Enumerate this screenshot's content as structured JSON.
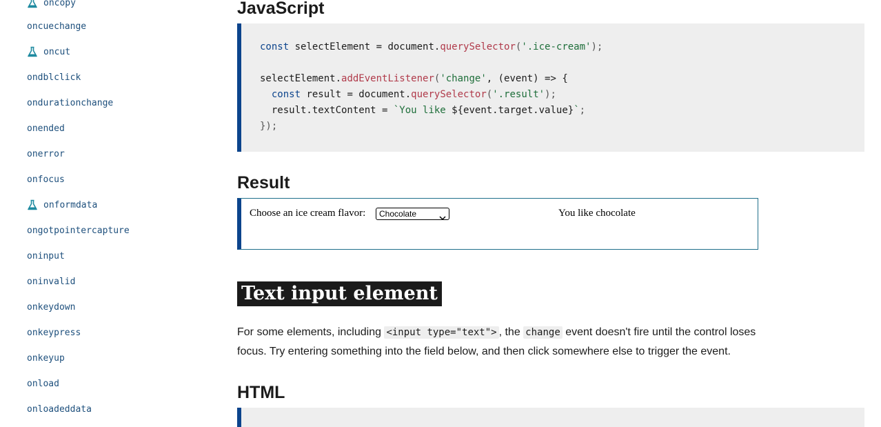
{
  "sidebar": {
    "items": [
      {
        "label": "oncopy",
        "experimental": true
      },
      {
        "label": "oncuechange",
        "experimental": false
      },
      {
        "label": "oncut",
        "experimental": true
      },
      {
        "label": "ondblclick",
        "experimental": false
      },
      {
        "label": "ondurationchange",
        "experimental": false
      },
      {
        "label": "onended",
        "experimental": false
      },
      {
        "label": "onerror",
        "experimental": false
      },
      {
        "label": "onfocus",
        "experimental": false
      },
      {
        "label": "onformdata",
        "experimental": true
      },
      {
        "label": "ongotpointercapture",
        "experimental": false
      },
      {
        "label": "oninput",
        "experimental": false
      },
      {
        "label": "oninvalid",
        "experimental": false
      },
      {
        "label": "onkeydown",
        "experimental": false
      },
      {
        "label": "onkeypress",
        "experimental": false
      },
      {
        "label": "onkeyup",
        "experimental": false
      },
      {
        "label": "onload",
        "experimental": false
      },
      {
        "label": "onloadeddata",
        "experimental": false
      }
    ],
    "experimental_icon": "flask-icon",
    "icon_color": "#1e8aa0"
  },
  "main": {
    "js_heading": "JavaScript",
    "code": {
      "l1_kw": "const",
      "l1_a": " selectElement = document.",
      "l1_fn": "querySelector",
      "l1_p1": "(",
      "l1_str": "'.ice-cream'",
      "l1_p2": ");",
      "l3_a": "selectElement.",
      "l3_fn": "addEventListener",
      "l3_p1": "(",
      "l3_str": "'change'",
      "l3_b": ", (event) => {",
      "l4_indent": "  ",
      "l4_kw": "const",
      "l4_a": " result = document.",
      "l4_fn": "querySelector",
      "l4_p1": "(",
      "l4_str": "'.result'",
      "l4_p2": ");",
      "l5_a": "  result.textContent = ",
      "l5_str1": "`You like ",
      "l5_tpl": "${event.target.value}",
      "l5_str2": "`",
      "l5_p": ";",
      "l6": "});"
    },
    "result_heading": "Result",
    "result": {
      "label": "Choose an ice cream flavor:",
      "select_value": "Chocolate",
      "output": "You like chocolate"
    },
    "section_heading": "Text input element",
    "para": {
      "t1": "For some elements, including ",
      "c1": "<input type=\"text\">",
      "t2": ", the ",
      "c2": "change",
      "t3": " event doesn't fire until the control loses focus. Try entering something into the field below, and then click somewhere else to trigger the event."
    },
    "html_heading": "HTML"
  },
  "colors": {
    "accent_border": "#0c448c",
    "link": "#1d4f7c",
    "code_bg": "#eeeeee"
  }
}
